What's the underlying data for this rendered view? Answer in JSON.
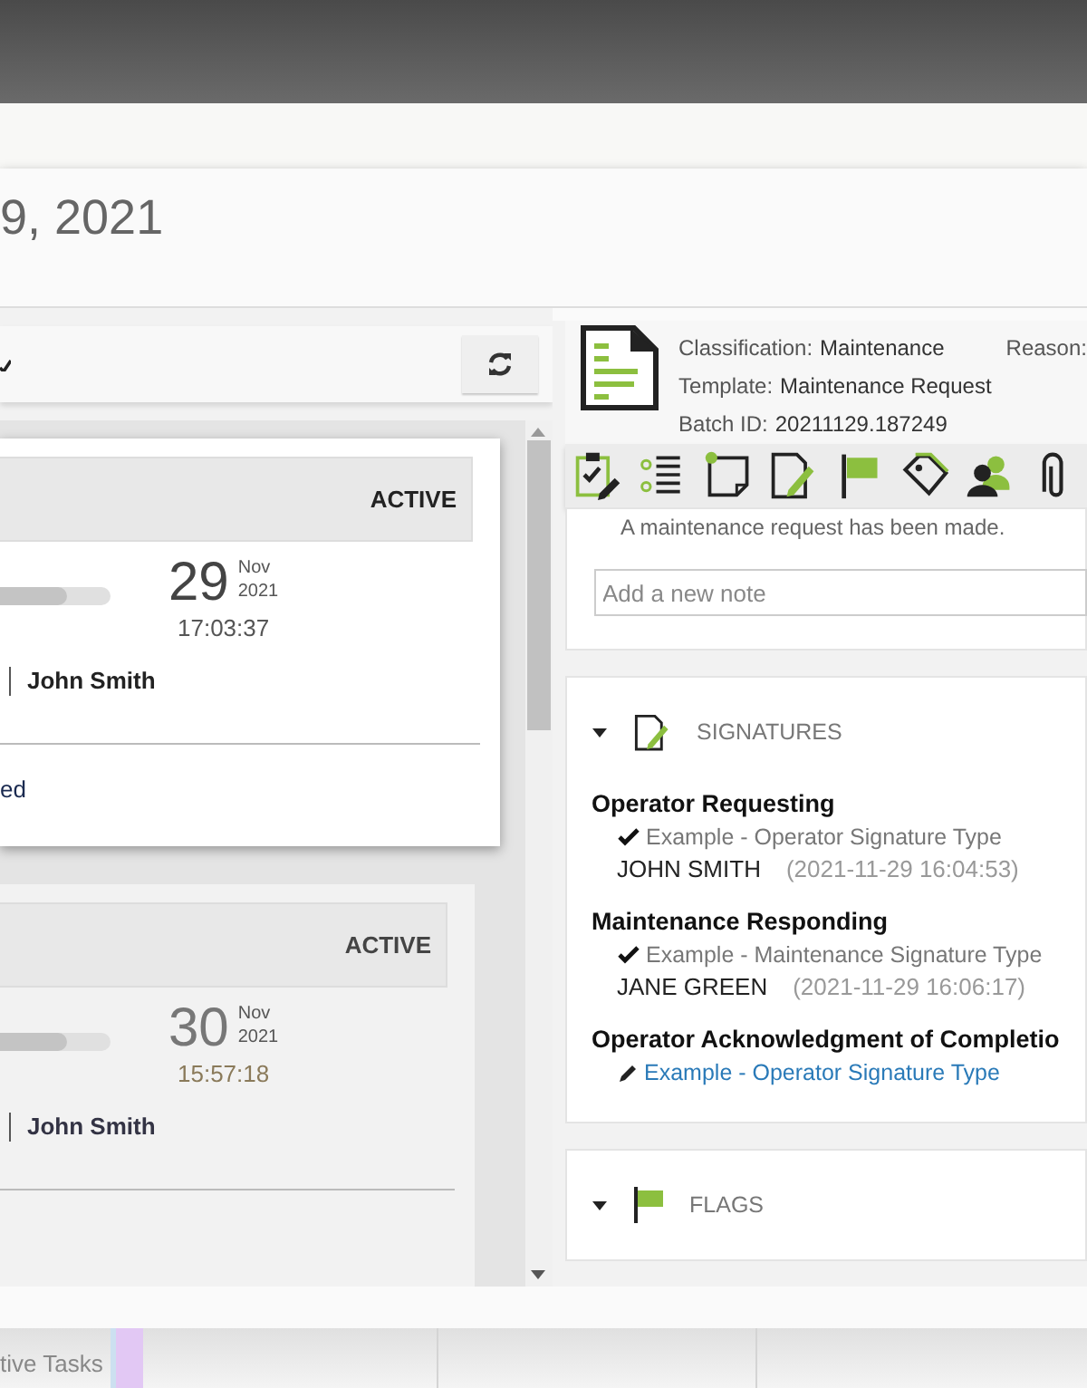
{
  "dialog": {
    "title": "9, 2021"
  },
  "tasks": [
    {
      "status": "ACTIVE",
      "selected": true,
      "level": 0.6,
      "day": "29",
      "month": "Nov",
      "year": "2021",
      "time": "17:03:37",
      "user": "John Smith",
      "footer": "ed"
    },
    {
      "status": "ACTIVE",
      "selected": false,
      "level": 0.6,
      "day": "30",
      "month": "Nov",
      "year": "2021",
      "time": "15:57:18",
      "user": "John Smith"
    }
  ],
  "details": {
    "fields": [
      {
        "label": "Classification:",
        "value": "Maintenance"
      },
      {
        "label": "Reason:"
      },
      {
        "label": "Template:",
        "value": "Maintenance Request"
      },
      {
        "label": "Batch ID:",
        "value": "20211129.187249"
      }
    ],
    "note_text": "A maintenance request has been made.",
    "note_input": {
      "placeholder": "Add a new note"
    },
    "signatures": {
      "title": "SIGNATURES",
      "expanded": true,
      "items": [
        {
          "kind": "signed",
          "role": "Operator Requesting",
          "type": "Example - Operator Signature Type",
          "signer": "JOHN SMITH",
          "timestamp": "(2021-11-29 16:04:53)"
        },
        {
          "kind": "signed",
          "role": "Maintenance Responding",
          "type": "Example - Maintenance Signature Type",
          "signer": "JANE GREEN",
          "timestamp": "(2021-11-29 16:06:17)"
        },
        {
          "kind": "pending",
          "role": "Operator Acknowledgment of Completio",
          "type": "Example - Operator Signature Type"
        }
      ]
    },
    "flags": {
      "title": "FLAGS",
      "expanded": true
    }
  },
  "taskbar": {
    "item": "tive Tasks"
  }
}
